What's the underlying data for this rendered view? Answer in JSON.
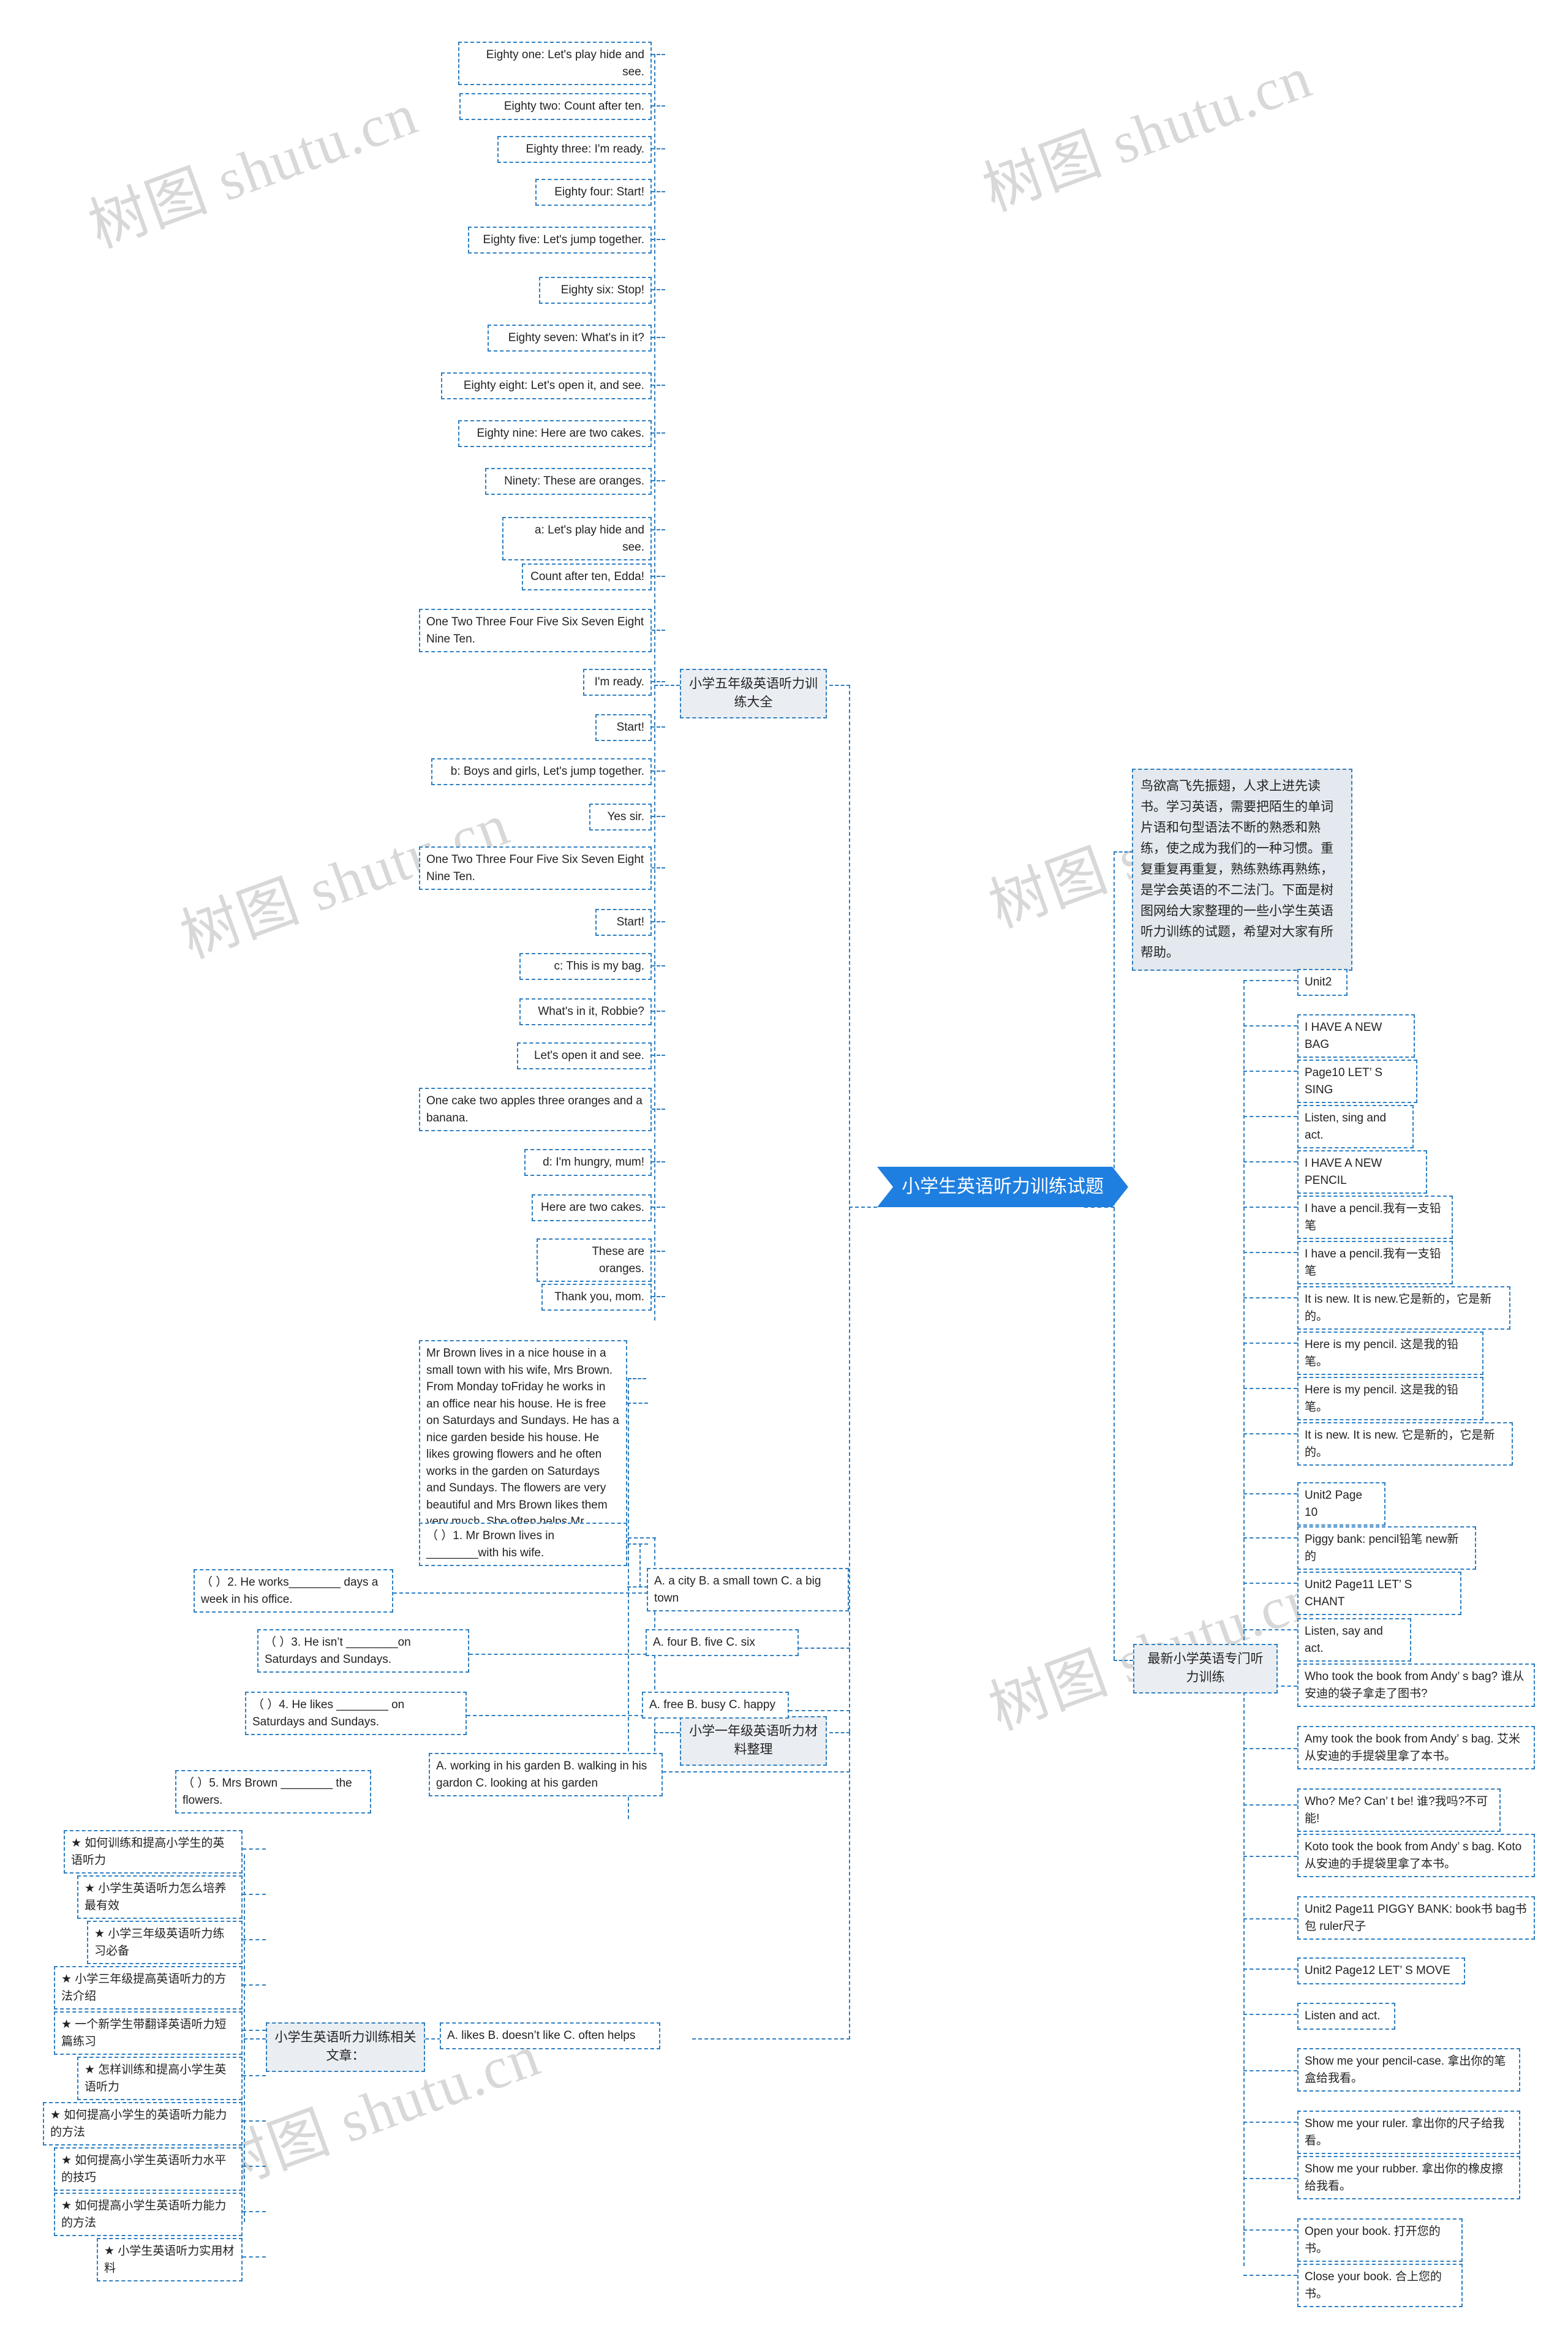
{
  "root": {
    "label": "小学生英语听力训练试题"
  },
  "summary": {
    "text": "鸟欲高飞先振翅，人求上进先读书。学习英语，需要把陌生的单词片语和句型语法不断的熟悉和熟练，使之成为我们的一种习惯。重复重复再重复，熟练熟练再熟练，是学会英语的不二法门。下面是树图网给大家整理的一些小学生英语听力训练的试题，希望对大家有所帮助。"
  },
  "branches": {
    "grade5": {
      "label": "小学五年级英语听力训练大全",
      "items": [
        "Eighty one: Let's play hide and see.",
        "Eighty two: Count after ten.",
        "Eighty three: I'm ready.",
        "Eighty four: Start!",
        "Eighty five: Let's jump together.",
        "Eighty six: Stop!",
        "Eighty seven: What's in it?",
        "Eighty eight: Let's open it, and see.",
        "Eighty nine: Here are two cakes.",
        "Ninety: These are oranges.",
        "a: Let's play hide and see.",
        "Count after ten, Edda!",
        "One Two Three Four Five Six Seven Eight Nine Ten.",
        "I'm ready.",
        "Start!",
        "b: Boys and girls, Let's jump together.",
        "Yes sir.",
        "One Two Three Four Five Six Seven Eight Nine Ten.",
        "Start!",
        "c: This is my bag.",
        "What's in it, Robbie?",
        "Let's open it and see.",
        "One cake two apples three oranges and a banana.",
        "d: I'm hungry, mum!",
        "Here are two cakes.",
        "These are oranges.",
        "Thank you, mom."
      ]
    },
    "grade1": {
      "label": "小学一年级英语听力材料整理",
      "passage": "Mr Brown lives in a nice house in a small town with his wife, Mrs Brown. From Monday toFriday he works in an office near his house. He is free on Saturdays and Sundays. He has a nice garden beside his house. He likes growing flowers and he often works in the garden on Saturdays and Sundays. The flowers are very beautiful and Mrs Brown likes them very much. She often helps Mr Brown.",
      "questions": [
        {
          "q": "（ ）1. Mr Brown lives in ________with his wife.",
          "options": "A. a city B. a small town C. a big town"
        },
        {
          "q": "（ ）2. He works________ days a week in his office.",
          "options": "A. four B. five C. six"
        },
        {
          "q": "（ ）3. He isn’t ________on Saturdays and Sundays.",
          "options": "A. free B. busy C. happy"
        },
        {
          "q": "（ ）4. He likes ________ on Saturdays and Sundays.",
          "options": "A. working in his garden B. walking in his gardon C. looking at his garden"
        },
        {
          "q": "（ ）5. Mrs Brown ________ the flowers.",
          "options": "A. likes B. doesn’t like C. often helps"
        }
      ]
    },
    "articles": {
      "label": "小学生英语听力训练相关文章：",
      "items": [
        "★ 如何训练和提高小学生的英语听力",
        "★ 小学生英语听力怎么培养最有效",
        "★ 小学三年级英语听力练习必备",
        "★ 小学三年级提高英语听力的方法介绍",
        "★ 一个新学生带翻译英语听力短篇练习",
        "★ 怎样训练和提高小学生英语听力",
        "★ 如何提高小学生的英语听力能力的方法",
        "★ 如何提高小学生英语听力水平的技巧",
        "★ 如何提高小学生英语听力能力的方法",
        "★ 小学生英语听力实用材料"
      ]
    },
    "newest": {
      "label": "最新小学英语专门听力训练",
      "items": [
        "Unit2",
        "I HAVE A NEW BAG",
        "Page10 LET’ S SING",
        "Listen, sing and act.",
        "I HAVE A NEW PENCIL",
        "I have a pencil.我有一支铅笔",
        "I have a pencil.我有一支铅笔",
        "It is new. It is new.它是新的，它是新的。",
        "Here is my pencil. 这是我的铅笔。",
        "Here is my pencil. 这是我的铅笔。",
        "It is new. It is new. 它是新的，它是新的。",
        "Unit2 Page 10",
        "Piggy bank: pencil铅笔 new新的",
        "Unit2 Page11 LET’ S CHANT",
        "Listen, say and act.",
        "Who took the book from Andy’ s bag? 谁从安迪的袋子拿走了图书?",
        "Amy took the book from Andy’ s bag. 艾米从安迪的手提袋里拿了本书。",
        "Who? Me? Can’ t be! 谁?我吗?不可能!",
        "Koto took the book from Andy’ s bag. Koto从安迪的手提袋里拿了本书。",
        "Unit2 Page11 PIGGY BANK: book书 bag书包 ruler尺子",
        "Unit2 Page12 LET’ S MOVE",
        "Listen and act.",
        "Show me your pencil-case. 拿出你的笔盒给我看。",
        "Show me your ruler. 拿出你的尺子给我看。",
        "Show me your rubber. 拿出你的橡皮擦给我看。",
        "Open your book. 打开您的书。",
        "Close your book. 合上您的书。"
      ]
    }
  },
  "watermarks": [
    "树图 shutu.cn",
    "树图 shutu.cn",
    "树图 shutu.cn",
    "树图 shutu.cn",
    "树图 shutu.cn",
    "树图 shutu.cn"
  ],
  "colors": {
    "accent": "#1f7fe0",
    "border": "#2f7fc1",
    "node_bg": "#ffffff",
    "level2_bg": "#eaeef2"
  }
}
